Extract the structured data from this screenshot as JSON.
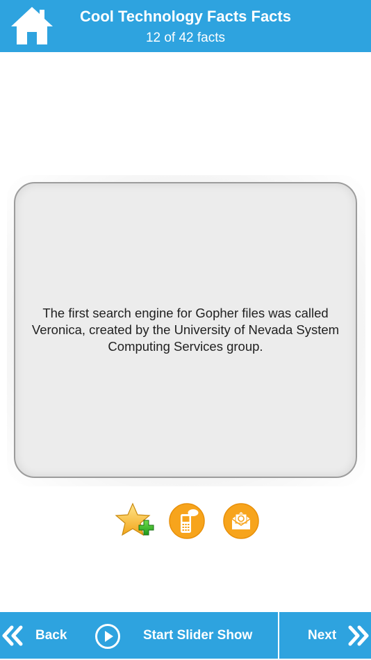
{
  "header": {
    "title": "Cool Technology Facts Facts",
    "subtitle": "12 of 42 facts",
    "home_icon": "home-icon",
    "background": "#2ea3df"
  },
  "fact": {
    "text": "The first search engine for Gopher files was called Veronica, created by the University of Nevada System Computing Services group."
  },
  "actions": [
    {
      "name": "favorite",
      "icon": "star-plus-icon"
    },
    {
      "name": "sms",
      "icon": "phone-sms-icon"
    },
    {
      "name": "email",
      "icon": "email-icon"
    }
  ],
  "footer": {
    "back_label": "Back",
    "slider_label": "Start Slider Show",
    "next_label": "Next",
    "back_icon": "double-chevron-left-icon",
    "play_icon": "play-circle-icon",
    "next_icon": "double-chevron-right-icon"
  },
  "colors": {
    "accent": "#2ea3df",
    "action_orange": "#f7a41c",
    "card_bg": "#ececec"
  }
}
